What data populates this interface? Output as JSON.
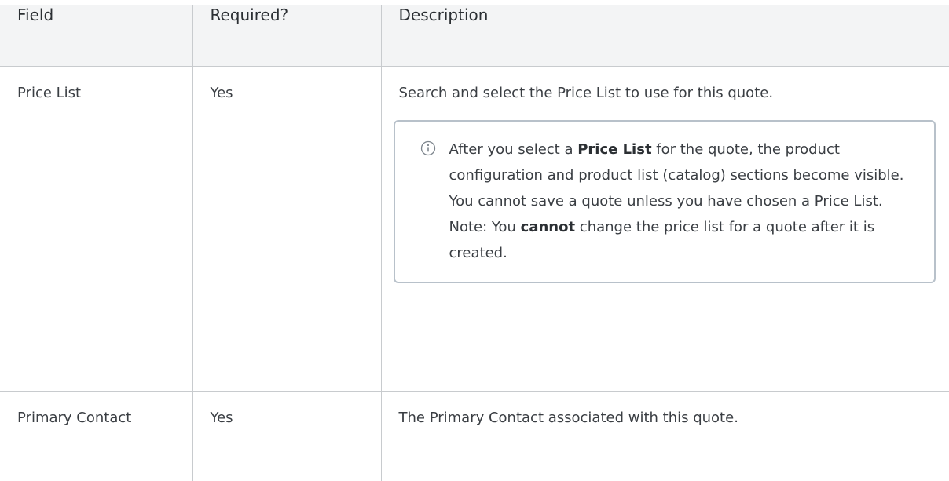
{
  "table": {
    "headers": {
      "field": "Field",
      "required": "Required?",
      "description": "Description"
    },
    "rows": [
      {
        "field": "Price List",
        "required": "Yes",
        "description": "Search and select the Price List to use for this quote.",
        "note": {
          "icon": "info-icon",
          "part1": "After you select a ",
          "bold1": "Price List",
          "part2": " for the quote, the product configuration and product list (catalog) sections become visible. You cannot save a quote unless you have chosen a Price List.",
          "part3": "Note: You ",
          "bold2": "cannot",
          "part4": " change the price list for a quote after it is created."
        }
      },
      {
        "field": "Primary Contact",
        "required": "Yes",
        "description": "The Primary Contact associated with this quote."
      }
    ]
  },
  "colors": {
    "header_bg": "#f3f4f5",
    "border": "#c8cbce",
    "note_border": "#b8c1ca",
    "text": "#3a3e43"
  }
}
